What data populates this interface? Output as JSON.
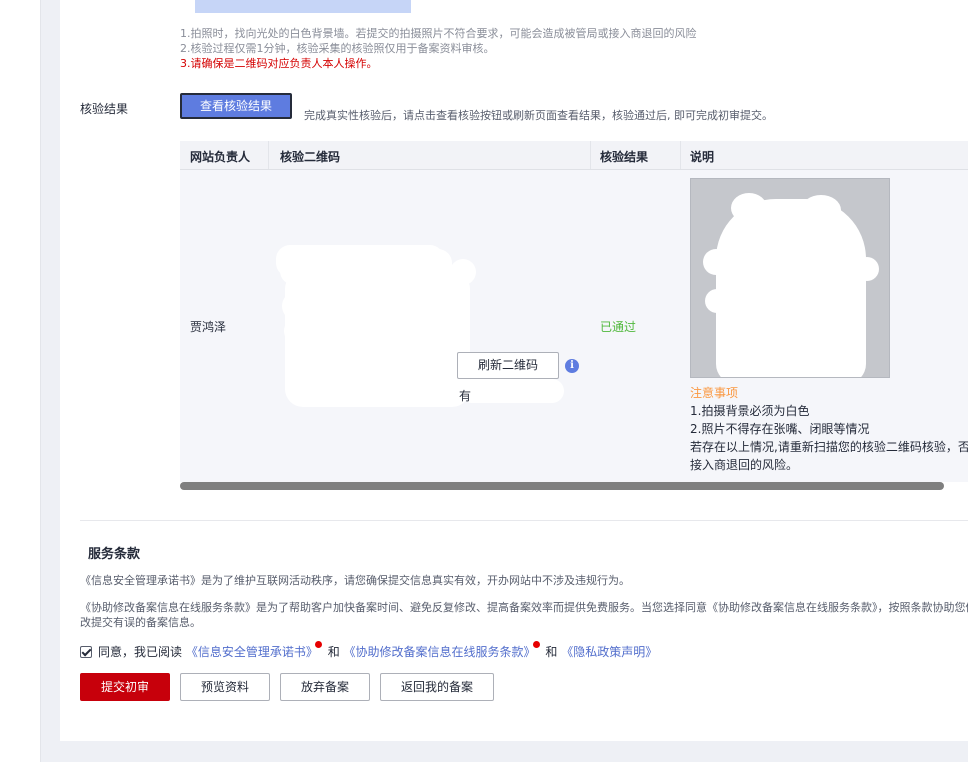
{
  "tips": [
    "1.拍照时，找向光处的白色背景墙。若提交的拍摄照片不符合要求，可能会造成被管局或接入商退回的风险",
    "2.核验过程仅需1分钟，核验采集的核验照仅用于备案资料审核。",
    "3.请确保是二维码对应负责人本人操作。"
  ],
  "verify": {
    "label": "核验结果",
    "button": "查看核验结果",
    "hint": "完成真实性核验后，请点击查看核验按钮或刷新页面查看结果，核验通过后, 即可完成初审提交。"
  },
  "table": {
    "headers": [
      "网站负责人",
      "核验二维码",
      "核验结果",
      "说明"
    ],
    "row": {
      "owner": "贾鸿泽",
      "refresh_button": "刷新二维码",
      "qr_note": "有",
      "result": "已通过",
      "notes_title": "注意事项",
      "notes": [
        "1.拍摄背景必须为白色",
        "2.照片不得存在张嘴、闭眼等情况",
        "若存在以上情况,请重新扫描您的核验二维码核验，否",
        "接入商退回的风险。"
      ]
    }
  },
  "terms": {
    "title": "服务条款",
    "p1": "《信息安全管理承诺书》是为了维护互联网活动秩序，请您确保提交信息真实有效，开办网站中不涉及违规行为。",
    "p2": "《协助修改备案信息在线服务条款》是为了帮助客户加快备案时间、避免反复修改、提高备案效率而提供免费服务。当您选择同意《协助修改备案信息在线服务条款》，按照条款协助您修改提交有误的备案信息。",
    "agree_prefix": "同意，我已阅读",
    "link1": "《信息安全管理承诺书》",
    "and1": "和",
    "link2": "《协助修改备案信息在线服务条款》",
    "and2": "和",
    "link3": "《隐私政策声明》"
  },
  "actions": {
    "submit": "提交初审",
    "preview": "预览资料",
    "abandon": "放弃备案",
    "back": "返回我的备案"
  },
  "icons": {
    "info": "info-icon",
    "check": "checkbox-checked-icon"
  },
  "colors": {
    "primary_red": "#c7000b",
    "blue_button": "#5e7ce0",
    "link_blue": "#526ecc",
    "pass_green": "#50b83c",
    "warn_orange": "#fa9841",
    "warn_red": "#d40000"
  }
}
